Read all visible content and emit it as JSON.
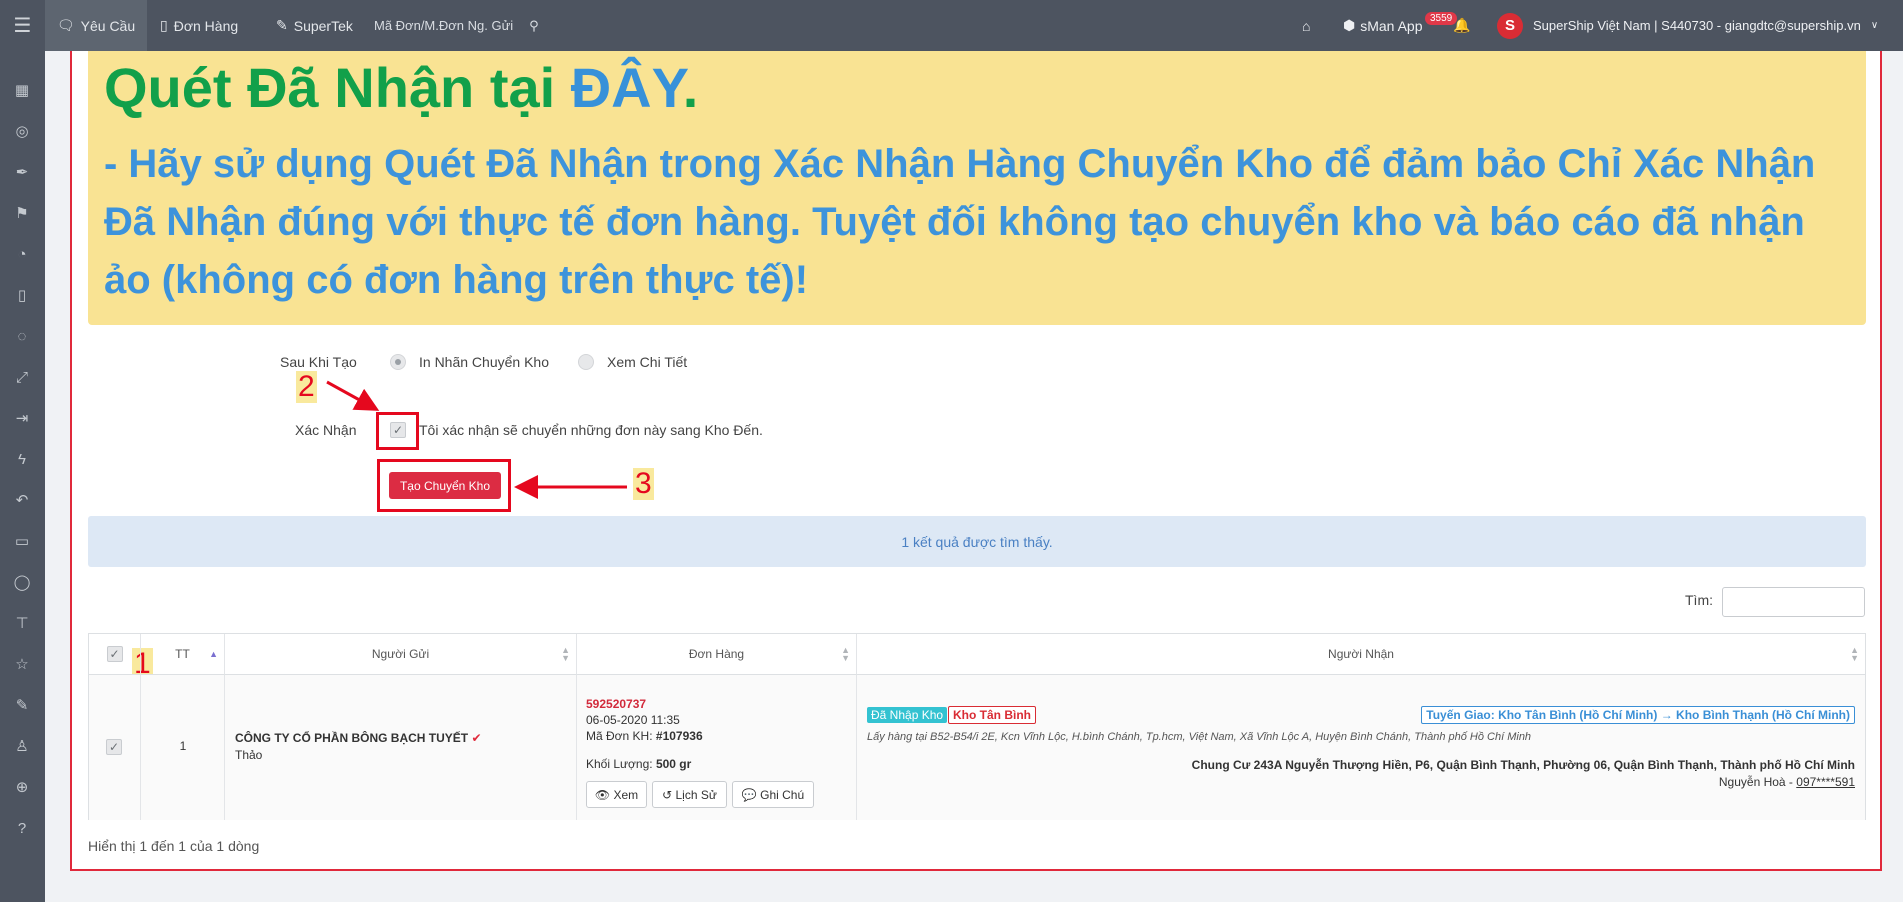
{
  "nav": {
    "tabs": [
      {
        "label": "Yêu Cầu",
        "icon": "chat-icon"
      },
      {
        "label": "Đơn Hàng",
        "icon": "book-icon"
      },
      {
        "label": "SuperTek",
        "icon": "edit-icon"
      }
    ],
    "search_placeholder": "Mã Đơn/M.Đơn Ng. Gửi",
    "app_label": "sMan App",
    "notification_count": "3559",
    "account": "SuperShip Việt Nam | S440730 - giangdtc@supership.vn"
  },
  "banner": {
    "title_green": "Quét Đã Nhận tại",
    "title_blue": "ĐÂY",
    "title_dot": ".",
    "notice": "- Hãy sử dụng Quét Đã Nhận trong Xác Nhận Hàng Chuyển Kho để đảm bảo Chỉ Xác Nhận Đã Nhận đúng với thực tế đơn hàng. Tuyệt đối không tạo chuyển kho và báo cáo đã nhận ảo (không có đơn hàng trên thực tế)!"
  },
  "form": {
    "after_create_label": "Sau Khi Tạo",
    "option_print": "In Nhãn Chuyển Kho",
    "option_view": "Xem Chi Tiết",
    "confirm_label": "Xác Nhận",
    "confirm_text": "Tôi xác nhận sẽ chuyển những đơn này sang Kho Đến.",
    "create_button": "Tạo Chuyển Kho"
  },
  "annotations": {
    "one": "1",
    "two": "2",
    "three": "3"
  },
  "result_text": "1 kết quả được tìm thấy.",
  "find_label": "Tìm:",
  "table": {
    "headers": {
      "tt": "TT",
      "sender": "Người Gửi",
      "order": "Đơn Hàng",
      "receiver": "Người Nhận"
    },
    "row": {
      "tt": "1",
      "sender_company": "CÔNG TY CỔ PHẦN BÔNG BẠCH TUYẾT",
      "sender_name": "Thảo",
      "order_code": "592520737",
      "order_time": "06-05-2020 11:35",
      "customer_code_label": "Mã Đơn KH:",
      "customer_code": "#107936",
      "weight_label": "Khối Lượng:",
      "weight": "500 gr",
      "btn_view": "Xem",
      "btn_history": "Lịch Sử",
      "btn_note": "Ghi Chú",
      "tag_status": "Đã Nhập Kho",
      "tag_warehouse": "Kho Tân Bình",
      "route": "Tuyến Giao: Kho Tân Bình (Hồ Chí Minh) → Kho Bình Thạnh (Hồ Chí Minh)",
      "pickup": "Lấy hàng tại B52-B54/i 2E, Kcn Vĩnh Lộc, H.bình Chánh, Tp.hcm, Việt Nam, Xã Vĩnh Lộc A, Huyện Bình Chánh, Thành phố Hồ Chí Minh",
      "address": "Chung Cư 243A Nguyễn Thượng Hiền, P6, Quận Bình Thạnh, Phường 06, Quận Bình Thạnh, Thành phố Hồ Chí Minh",
      "receiver_name": "Nguyễn Hoà -",
      "receiver_phone": "097****591"
    }
  },
  "footer": "Hiển thị 1 đến 1 của 1 dòng",
  "colors": {
    "accent_red": "#dc2c43",
    "banner_bg": "#f9e393",
    "title_green": "#12a04a",
    "title_blue": "#3791d9"
  }
}
